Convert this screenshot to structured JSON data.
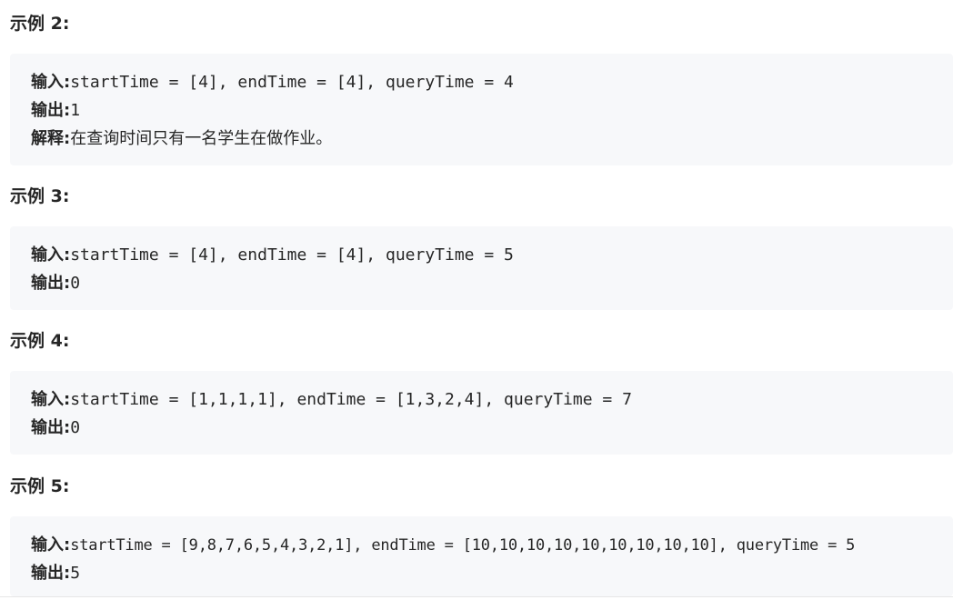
{
  "examples": [
    {
      "heading": "示例 2:",
      "input_label": "输入:",
      "input_value": "startTime = [4], endTime = [4], queryTime = 4",
      "output_label": "输出:",
      "output_value": "1",
      "explain_label": "解释:",
      "explain_value": "在查询时间只有一名学生在做作业。"
    },
    {
      "heading": "示例 3:",
      "input_label": "输入:",
      "input_value": "startTime = [4], endTime = [4], queryTime = 5",
      "output_label": "输出:",
      "output_value": "0"
    },
    {
      "heading": "示例 4:",
      "input_label": "输入:",
      "input_value": "startTime = [1,1,1,1], endTime = [1,3,2,4], queryTime = 7",
      "output_label": "输出:",
      "output_value": "0"
    },
    {
      "heading": "示例 5:",
      "input_label": "输入:",
      "input_value": "startTime = [9,8,7,6,5,4,3,2,1], endTime = [10,10,10,10,10,10,10,10,10], queryTime = 5",
      "output_label": "输出:",
      "output_value": "5"
    }
  ]
}
